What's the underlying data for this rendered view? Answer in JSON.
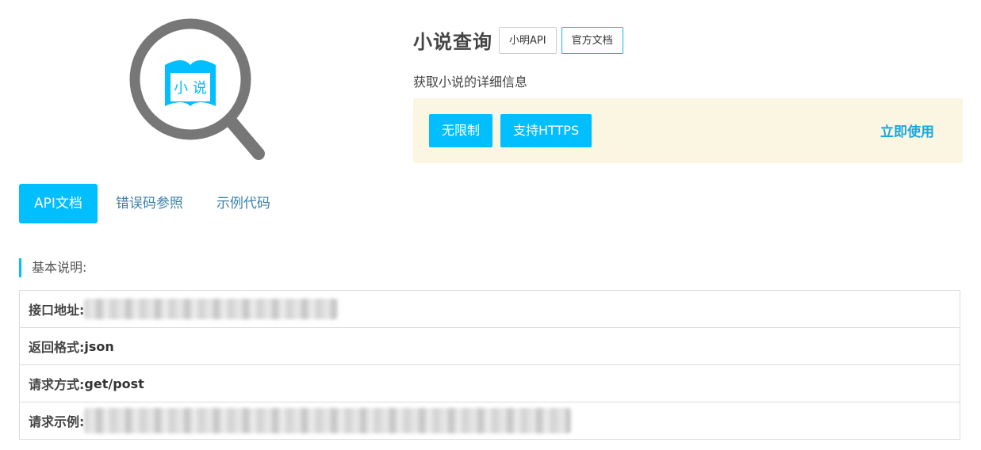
{
  "header": {
    "title": "小说查询",
    "tag_buttons": [
      "小明API",
      "官方文档"
    ],
    "description": "获取小说的详细信息",
    "features": [
      "无限制",
      "支持HTTPS"
    ],
    "use_now": "立即使用"
  },
  "logo": {
    "book_text": "小 说"
  },
  "tabs": [
    "API文档",
    "错误码参照",
    "示例代码"
  ],
  "basic_section": {
    "heading": "基本说明:",
    "rows": [
      {
        "label": "接口地址:",
        "value": ""
      },
      {
        "label": "返回格式:",
        "value": "json"
      },
      {
        "label": "请求方式:",
        "value": "get/post"
      },
      {
        "label": "请求示例:",
        "value": ""
      }
    ]
  },
  "colors": {
    "accent": "#01beff",
    "panel_bg": "#fbf6e1",
    "logo_gray": "#777777"
  }
}
